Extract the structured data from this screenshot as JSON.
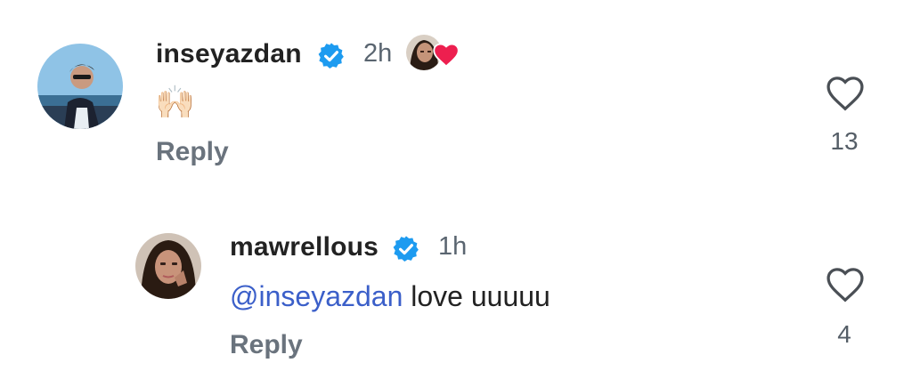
{
  "comments": [
    {
      "username": "inseyazdan",
      "time": "2h",
      "text": "🙌🏻",
      "reply_label": "Reply",
      "like_count": "13"
    },
    {
      "username": "mawrellous",
      "time": "1h",
      "mention": "@inseyazdan",
      "text": " love uuuuu",
      "reply_label": "Reply",
      "like_count": "4"
    }
  ],
  "colors": {
    "verified": "#1d9bf0",
    "mention": "#3b5fc9",
    "heart": "#ed1f4f"
  },
  "icons": [
    "verified-badge-icon",
    "heart-outline-icon",
    "threads-at-icon",
    "heart-filled-icon"
  ]
}
